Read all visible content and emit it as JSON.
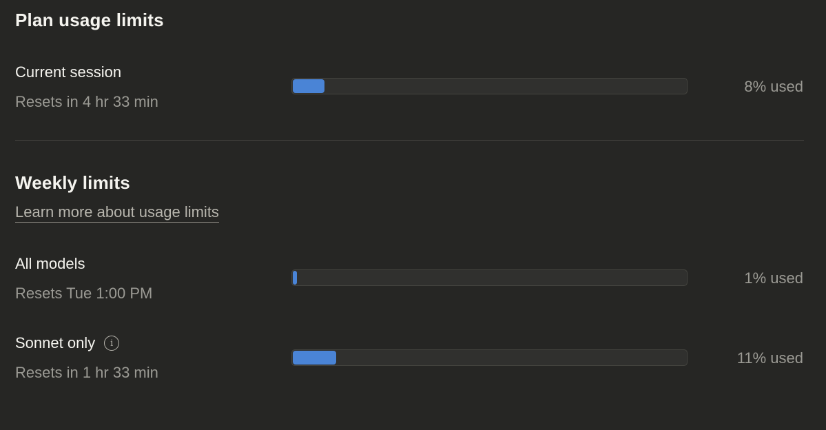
{
  "plan": {
    "title": "Plan usage limits",
    "current_session": {
      "label": "Current session",
      "reset_text": "Resets in 4 hr 33 min",
      "percent": 8,
      "value_text": "8% used"
    }
  },
  "weekly": {
    "title": "Weekly limits",
    "learn_more_label": "Learn more about usage limits",
    "items": [
      {
        "label": "All models",
        "reset_text": "Resets Tue 1:00 PM",
        "percent": 1,
        "value_text": "1% used",
        "info_icon": false
      },
      {
        "label": "Sonnet only",
        "reset_text": "Resets in 1 hr 33 min",
        "percent": 11,
        "value_text": "11% used",
        "info_icon": true,
        "info_icon_name": "info-icon"
      }
    ]
  },
  "colors": {
    "background": "#262624",
    "bar_fill": "#4a84d6",
    "bar_track": "#30302e",
    "primary_text": "#f5f4ef",
    "secondary_text": "#9b9a94"
  }
}
